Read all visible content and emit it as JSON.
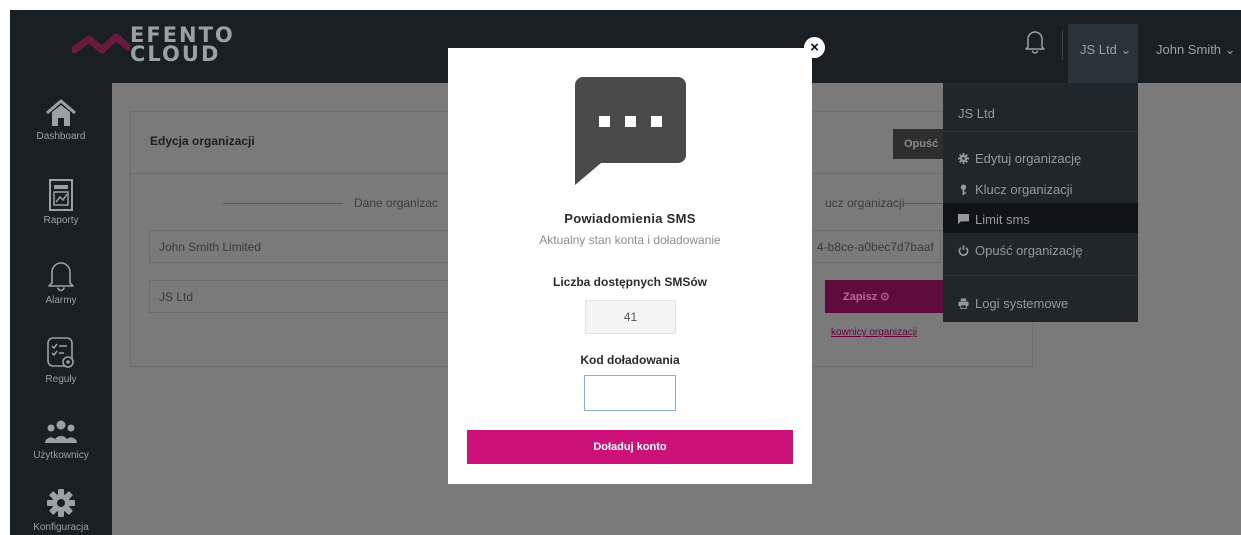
{
  "header": {
    "logo_line1": "EFENTO",
    "logo_line2": "CLOUD",
    "org_selector": "JS Ltd ⌄",
    "user_menu": "John Smith ⌄"
  },
  "sidebar": {
    "items": [
      {
        "label": "Dashboard",
        "icon": "home-icon"
      },
      {
        "label": "Raporty",
        "icon": "report-icon"
      },
      {
        "label": "Alarmy",
        "icon": "bell-icon"
      },
      {
        "label": "Reguły",
        "icon": "rules-icon"
      },
      {
        "label": "Użytkownicy",
        "icon": "users-icon"
      },
      {
        "label": "Konfiguracja",
        "icon": "gear-icon"
      }
    ]
  },
  "page": {
    "title": "Edycja organizacji",
    "leave_button": "Opuść",
    "section_left": "Dane organizac",
    "section_right": "ucz organizacji",
    "org_name_value": "John Smith Limited",
    "org_short_value": "JS Ltd",
    "org_key_value": "4-b8ce-a0bec7d7baaf",
    "save_button": "Zapisz ⊙",
    "users_link": "kownicy organizacji"
  },
  "dropdown": {
    "header": "JS Ltd",
    "items": [
      {
        "label": "Edytuj organizację",
        "icon": "gear-icon"
      },
      {
        "label": "Klucz organizacji",
        "icon": "key-icon"
      },
      {
        "label": "Limit sms",
        "icon": "message-icon"
      },
      {
        "label": "Opuść organizację",
        "icon": "power-icon"
      }
    ],
    "logs": {
      "label": "Logi systemowe",
      "icon": "printer-icon"
    }
  },
  "modal": {
    "close": "×",
    "title": "Powiadomienia SMS",
    "subtitle": "Aktualny stan konta i doładowanie",
    "available_label": "Liczba dostępnych SMSów",
    "available_count": "41",
    "code_label": "Kod doładowania",
    "code_value": "",
    "topup_button": "Doładuj konto"
  },
  "colors": {
    "accent": "#cc1279",
    "sidebar_bg": "#1a1f24",
    "overlay": "#7a7a7a",
    "sms_icon": "#4a4a4a"
  }
}
